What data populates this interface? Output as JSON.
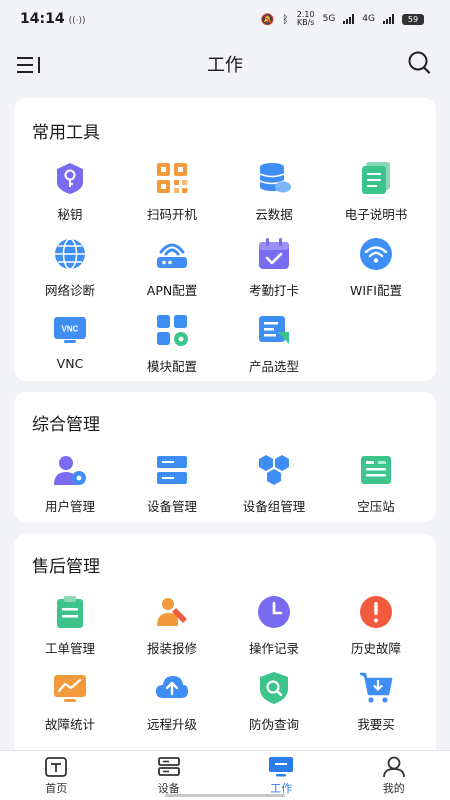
{
  "status": {
    "time": "14:14",
    "nfc": "((·))",
    "speed_value": "2.10",
    "speed_unit": "KB/s",
    "net1": "5G",
    "net2": "4G",
    "battery": "59"
  },
  "header": {
    "title": "工作"
  },
  "sections": {
    "common": {
      "title": "常用工具",
      "items": [
        "秘钥",
        "扫码开机",
        "云数据",
        "电子说明书",
        "网络诊断",
        "APN配置",
        "考勤打卡",
        "WIFI配置",
        "VNC",
        "模块配置",
        "产品选型"
      ],
      "icon_text_vnc": "VNC"
    },
    "management": {
      "title": "综合管理",
      "items": [
        "用户管理",
        "设备管理",
        "设备组管理",
        "空压站"
      ]
    },
    "aftersales": {
      "title": "售后管理",
      "items": [
        "工单管理",
        "报装报修",
        "操作记录",
        "历史故障",
        "故障统计",
        "远程升级",
        "防伪查询",
        "我要买"
      ]
    }
  },
  "tabs": [
    "首页",
    "设备",
    "工作",
    "我的"
  ],
  "colors": {
    "accent": "#2b7de9",
    "blue": "#3f8ef3",
    "purple": "#7a6cf0",
    "orange": "#f39a3c",
    "green": "#3cc48a",
    "red": "#f25a3e"
  }
}
